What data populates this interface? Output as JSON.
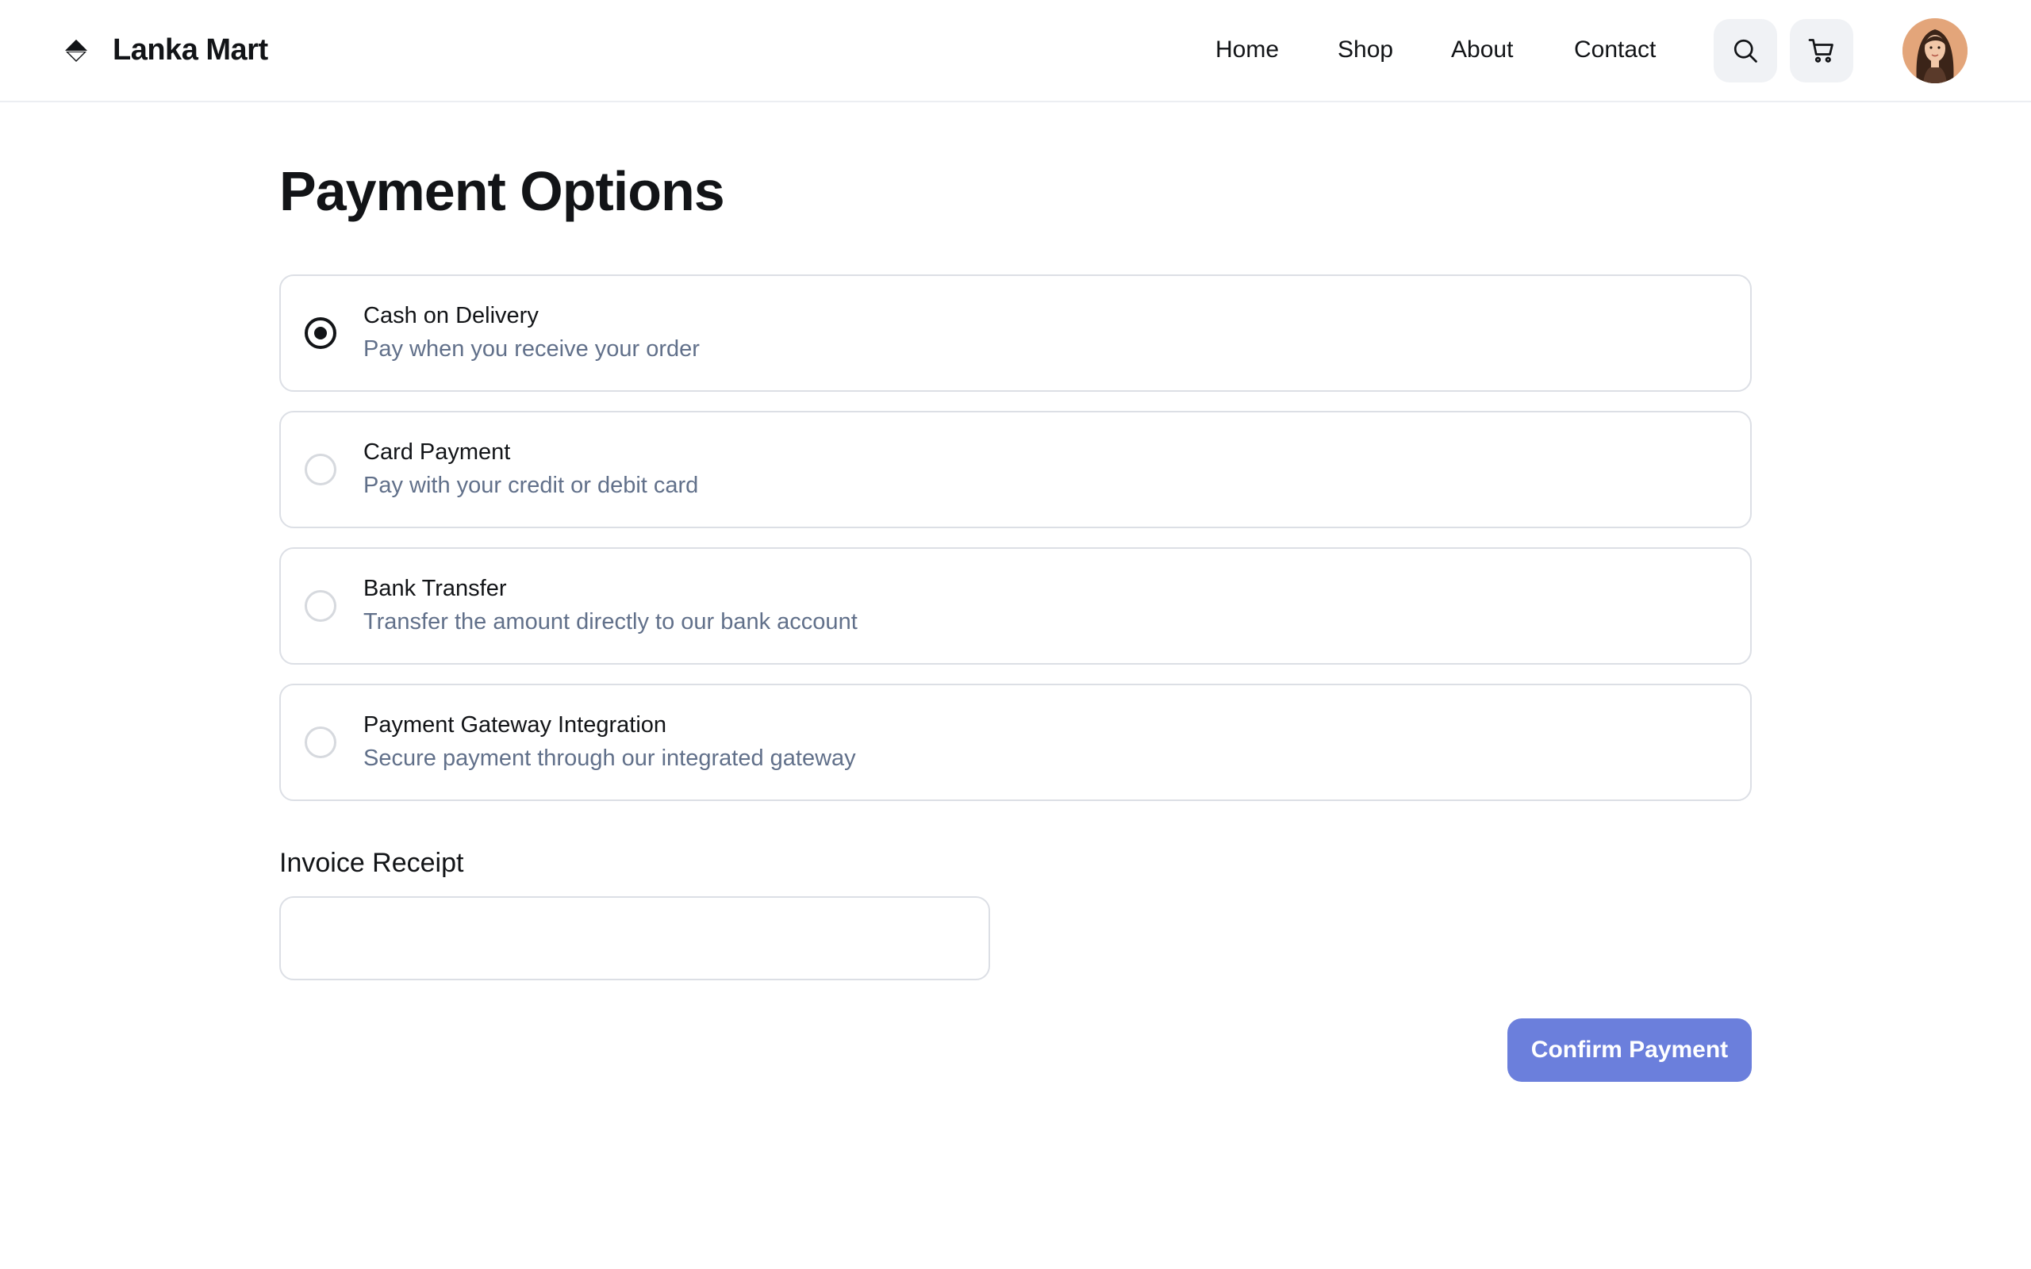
{
  "header": {
    "brand_name": "Lanka Mart",
    "brand_icon": "diamond-logo-icon",
    "nav": [
      {
        "label": "Home"
      },
      {
        "label": "Shop"
      },
      {
        "label": "About"
      },
      {
        "label": "Contact"
      }
    ],
    "search_icon": "search-icon",
    "cart_icon": "cart-icon",
    "avatar": "user-avatar"
  },
  "main": {
    "title": "Payment Options",
    "options": [
      {
        "title": "Cash on Delivery",
        "description": "Pay when you receive your order",
        "selected": true
      },
      {
        "title": "Card Payment",
        "description": "Pay with your credit or debit card",
        "selected": false
      },
      {
        "title": "Bank Transfer",
        "description": "Transfer the amount directly to our bank account",
        "selected": false
      },
      {
        "title": "Payment Gateway Integration",
        "description": "Secure payment through our integrated gateway",
        "selected": false
      }
    ],
    "invoice_label": "Invoice Receipt",
    "invoice_value": "",
    "invoice_placeholder": "",
    "confirm_label": "Confirm Payment"
  },
  "colors": {
    "accent": "#6b7fdc",
    "text": "#121417",
    "muted": "#61708a",
    "border": "#dcdfe5"
  }
}
